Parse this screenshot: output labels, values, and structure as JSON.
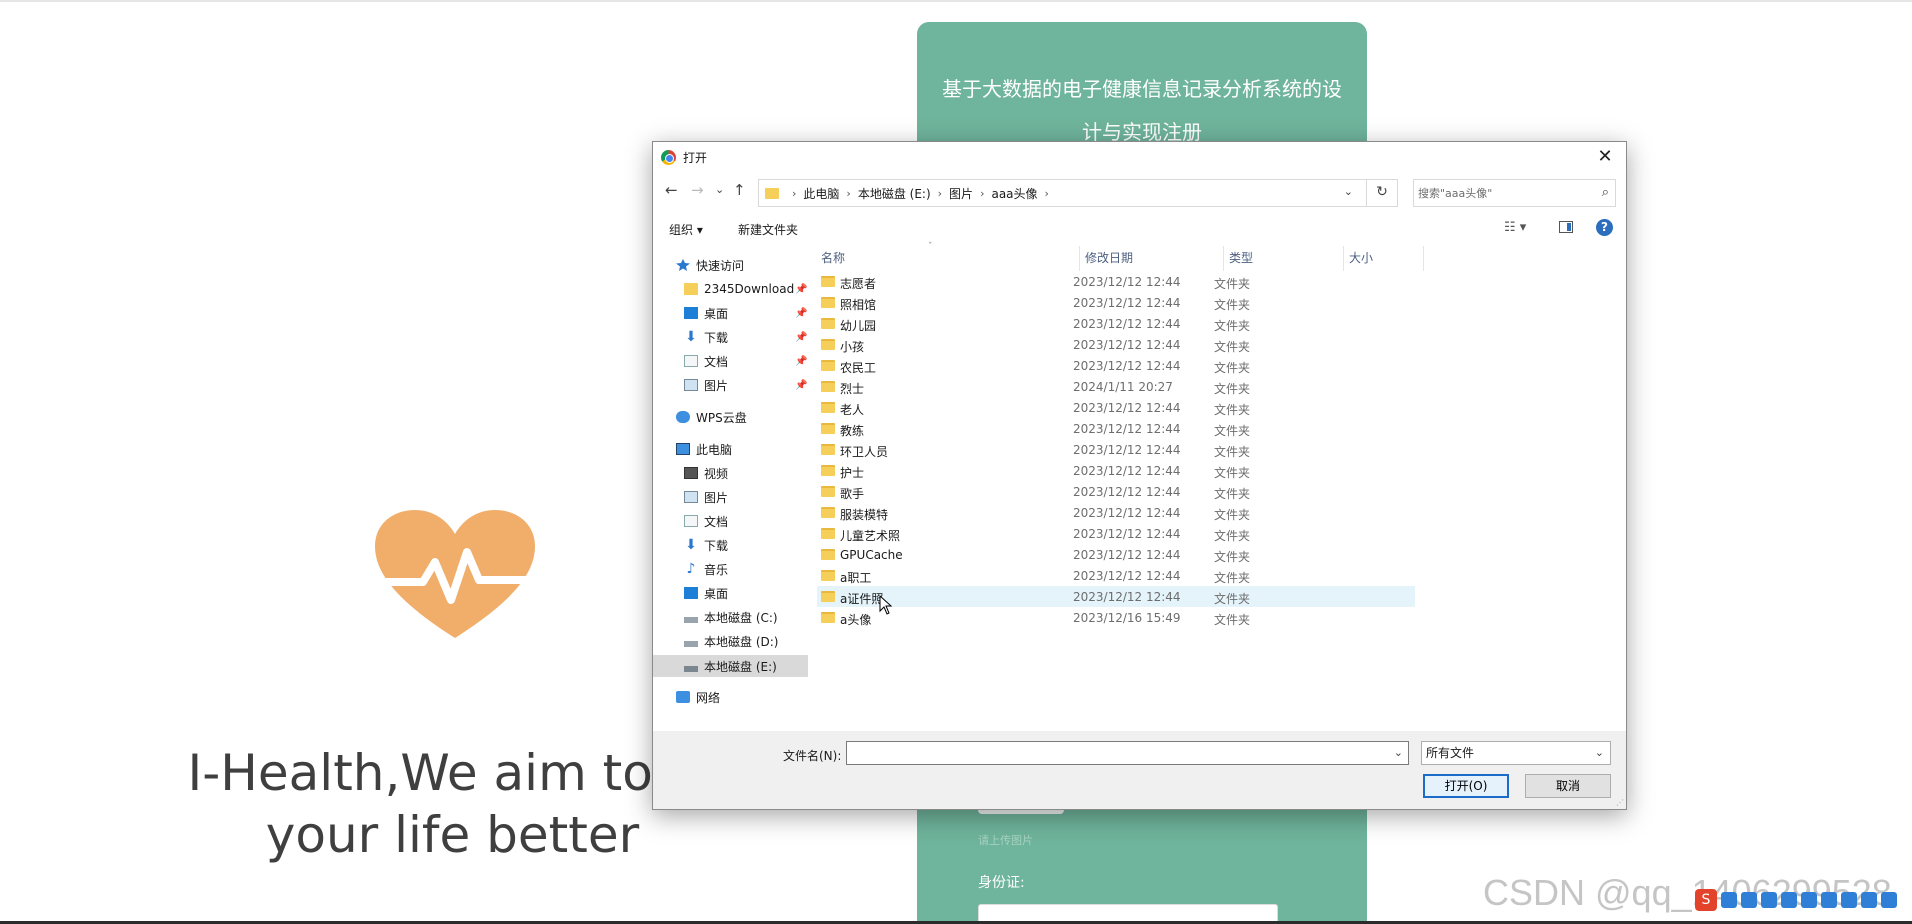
{
  "page": {
    "register_title": "基于大数据的电子健康信息记录分析系统的设计与实现注册",
    "slogan_line1": "I-Health,We aim to m",
    "slogan_line2": "your life better",
    "upload_hint": "请上传图片",
    "id_label": "身份证:",
    "brand_color": "#6fb49c",
    "heart_color": "#f0ae6a"
  },
  "watermark": "CSDN @qq_1406299528",
  "tray": {
    "ime_label": "S"
  },
  "dialog": {
    "title": "打开",
    "close_glyph": "✕",
    "nav": {
      "back": "←",
      "forward": "→",
      "recent": "⌄",
      "up": "↑",
      "refresh": "↻",
      "dropdown": "⌄"
    },
    "breadcrumb": [
      "此电脑",
      "本地磁盘 (E:)",
      "图片",
      "aaa头像"
    ],
    "search_placeholder": "搜索\"aaa头像\"",
    "toolbar": {
      "organize": "组织 ▾",
      "new_folder": "新建文件夹",
      "view": "☷ ▾",
      "help": "?"
    },
    "nav_pane": [
      {
        "label": "快速访问",
        "icon": "star-icon"
      },
      {
        "label": "2345Download",
        "icon": "folder-icon",
        "pinned": true
      },
      {
        "label": "桌面",
        "icon": "desktop-icon",
        "pinned": true
      },
      {
        "label": "下载",
        "icon": "download-icon",
        "pinned": true
      },
      {
        "label": "文档",
        "icon": "document-icon",
        "pinned": true
      },
      {
        "label": "图片",
        "icon": "picture-icon",
        "pinned": true
      },
      {
        "label": "WPS云盘",
        "icon": "cloud-icon"
      },
      {
        "label": "此电脑",
        "icon": "computer-icon"
      },
      {
        "label": "视频",
        "icon": "video-icon"
      },
      {
        "label": "图片",
        "icon": "picture-icon"
      },
      {
        "label": "文档",
        "icon": "document-icon"
      },
      {
        "label": "下载",
        "icon": "download-icon"
      },
      {
        "label": "音乐",
        "icon": "music-icon"
      },
      {
        "label": "桌面",
        "icon": "desktop-icon"
      },
      {
        "label": "本地磁盘 (C:)",
        "icon": "drive-icon"
      },
      {
        "label": "本地磁盘 (D:)",
        "icon": "drive-icon"
      },
      {
        "label": "本地磁盘 (E:)",
        "icon": "drive-icon",
        "selected": true
      },
      {
        "label": "网络",
        "icon": "network-icon"
      }
    ],
    "columns": {
      "name": "名称",
      "date": "修改日期",
      "type": "类型",
      "size": "大小"
    },
    "files": [
      {
        "name": "志愿者",
        "date": "2023/12/12 12:44",
        "type": "文件夹"
      },
      {
        "name": "照相馆",
        "date": "2023/12/12 12:44",
        "type": "文件夹"
      },
      {
        "name": "幼儿园",
        "date": "2023/12/12 12:44",
        "type": "文件夹"
      },
      {
        "name": "小孩",
        "date": "2023/12/12 12:44",
        "type": "文件夹"
      },
      {
        "name": "农民工",
        "date": "2023/12/12 12:44",
        "type": "文件夹"
      },
      {
        "name": "烈士",
        "date": "2024/1/11 20:27",
        "type": "文件夹"
      },
      {
        "name": "老人",
        "date": "2023/12/12 12:44",
        "type": "文件夹"
      },
      {
        "name": "教练",
        "date": "2023/12/12 12:44",
        "type": "文件夹"
      },
      {
        "name": "环卫人员",
        "date": "2023/12/12 12:44",
        "type": "文件夹"
      },
      {
        "name": "护士",
        "date": "2023/12/12 12:44",
        "type": "文件夹"
      },
      {
        "name": "歌手",
        "date": "2023/12/12 12:44",
        "type": "文件夹"
      },
      {
        "name": "服装模特",
        "date": "2023/12/12 12:44",
        "type": "文件夹"
      },
      {
        "name": "儿童艺术照",
        "date": "2023/12/12 12:44",
        "type": "文件夹"
      },
      {
        "name": "GPUCache",
        "date": "2023/12/12 12:44",
        "type": "文件夹"
      },
      {
        "name": "a职工",
        "date": "2023/12/12 12:44",
        "type": "文件夹"
      },
      {
        "name": "a证件照",
        "date": "2023/12/12 12:44",
        "type": "文件夹",
        "hover": true
      },
      {
        "name": "a头像",
        "date": "2023/12/16 15:49",
        "type": "文件夹"
      }
    ],
    "filename_label": "文件名(N):",
    "filename_value": "",
    "filetype_selected": "所有文件",
    "open_button": "打开(O)",
    "cancel_button": "取消"
  }
}
